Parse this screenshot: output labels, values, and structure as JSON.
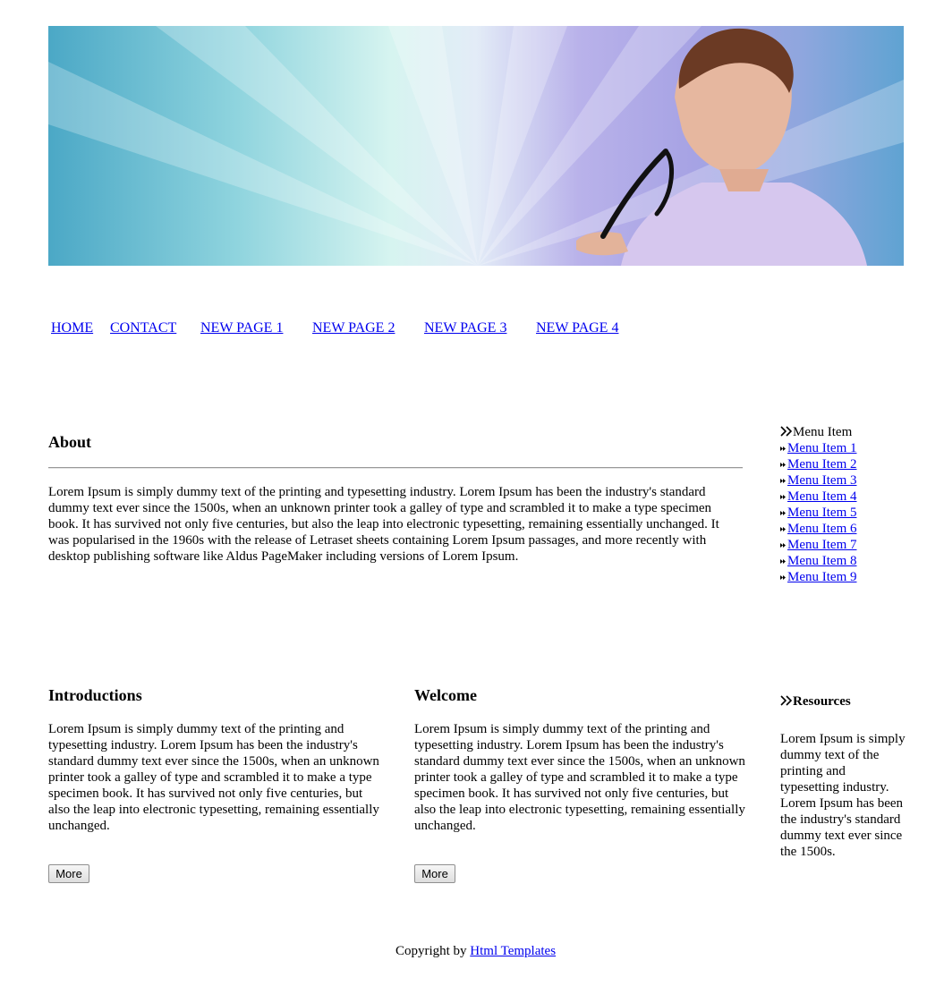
{
  "header": {
    "banner_image": "banner-woman-holding-glasses"
  },
  "nav": {
    "items": [
      {
        "label": "HOME"
      },
      {
        "label": "CONTACT"
      },
      {
        "label": "NEW PAGE 1"
      },
      {
        "label": "NEW PAGE 2"
      },
      {
        "label": "NEW PAGE 3"
      },
      {
        "label": "NEW PAGE 4"
      }
    ]
  },
  "about": {
    "title": "About",
    "text": "Lorem Ipsum is simply dummy text of the printing and typesetting industry. Lorem Ipsum has been the industry's standard dummy text ever since the 1500s, when an unknown printer took a galley of type and scrambled it to make a type specimen book. It has survived not only five centuries, but also the leap into electronic typesetting, remaining essentially unchanged. It was popularised in the 1960s with the release of Letraset sheets containing Lorem Ipsum passages, and more recently with desktop publishing software like Aldus PageMaker including versions of Lorem Ipsum."
  },
  "sidebar": {
    "menu_title": "Menu Item",
    "menu_items": [
      {
        "label": "Menu Item 1"
      },
      {
        "label": "Menu Item 2"
      },
      {
        "label": "Menu Item 3"
      },
      {
        "label": "Menu Item 4"
      },
      {
        "label": "Menu Item 5"
      },
      {
        "label": "Menu Item 6"
      },
      {
        "label": "Menu Item 7"
      },
      {
        "label": "Menu Item 8"
      },
      {
        "label": "Menu Item 9"
      }
    ],
    "resources_title": "Resources",
    "resources_text": "Lorem Ipsum is simply dummy text of the printing and typesetting industry. Lorem Ipsum has been the industry's standard dummy text ever since the 1500s."
  },
  "columns": [
    {
      "title": "Introductions",
      "text": "Lorem Ipsum is simply dummy text of the printing and typesetting industry. Lorem Ipsum has been the industry's standard dummy text ever since the 1500s, when an unknown printer took a galley of type and scrambled it to make a type specimen book. It has survived not only five centuries, but also the leap into electronic typesetting, remaining essentially unchanged.",
      "button": "More"
    },
    {
      "title": "Welcome",
      "text": "Lorem Ipsum is simply dummy text of the printing and typesetting industry. Lorem Ipsum has been the industry's standard dummy text ever since the 1500s, when an unknown printer took a galley of type and scrambled it to make a type specimen book. It has survived not only five centuries, but also the leap into electronic typesetting, remaining essentially unchanged.",
      "button": "More"
    }
  ],
  "footer": {
    "prefix": "Copyright by ",
    "link": "Html Templates"
  },
  "icons": {
    "menu_title_icon": "double-chevron-right-icon",
    "menu_bullet_icon": "small-double-arrow-icon"
  },
  "colors": {
    "link": "#0000ee",
    "banner_left": "#4ba8c6",
    "banner_mid": "#d6f4f0",
    "banner_right": "#a7a3e4"
  }
}
